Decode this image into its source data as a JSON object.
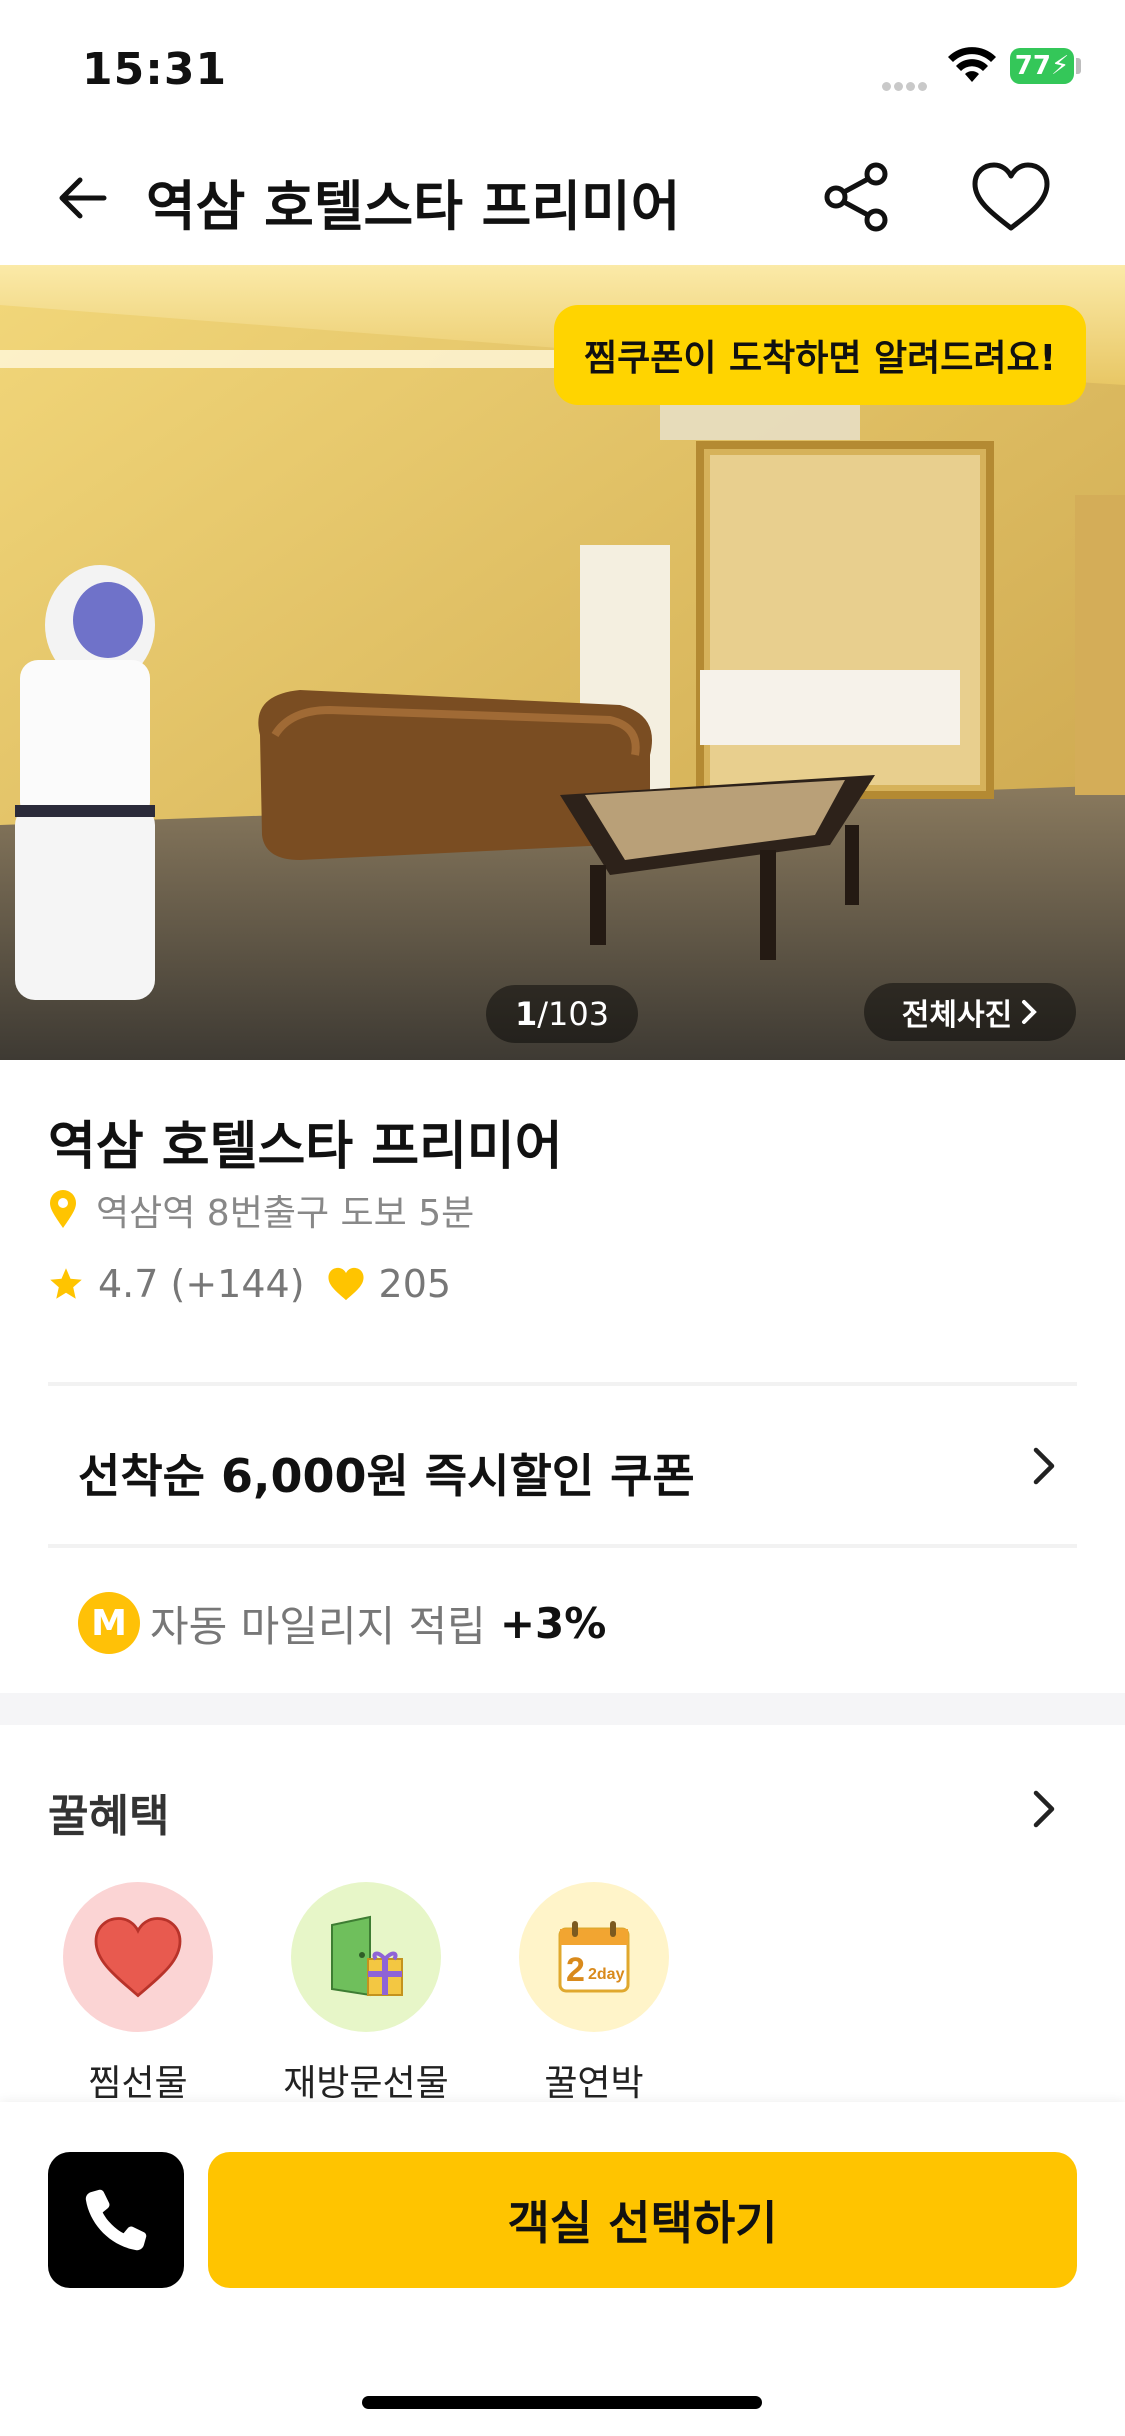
{
  "status_bar": {
    "time": "15:31",
    "battery": "77"
  },
  "header": {
    "title": "역삼 호텔스타 프리미어"
  },
  "hero": {
    "coupon_banner": "찜쿠폰이 도착하면 알려드려요!",
    "photo_index": "1",
    "photo_total": "/103",
    "all_photos_label": "전체사진"
  },
  "hotel": {
    "name": "역삼 호텔스타 프리미어",
    "location": "역삼역 8번출구 도보 5분",
    "rating": "4.7 (+144)",
    "likes": "205"
  },
  "coupon": {
    "text": "선착순 6,000원 즉시할인 쿠폰"
  },
  "mileage": {
    "icon_letter": "M",
    "label": "자동 마일리지 적립",
    "value": "+3%"
  },
  "benefits": {
    "title": "꿀혜택",
    "items": [
      {
        "label": "찜선물",
        "icon": "heart-icon"
      },
      {
        "label": "재방문선물",
        "icon": "door-gift-icon"
      },
      {
        "label": "꿀연박",
        "icon": "calendar-2day-icon",
        "badge": "2day"
      }
    ]
  },
  "bottom": {
    "select_room_label": "객실 선택하기"
  },
  "colors": {
    "accent": "#ffc400",
    "banner": "#ffd400",
    "battery": "#34c759"
  }
}
